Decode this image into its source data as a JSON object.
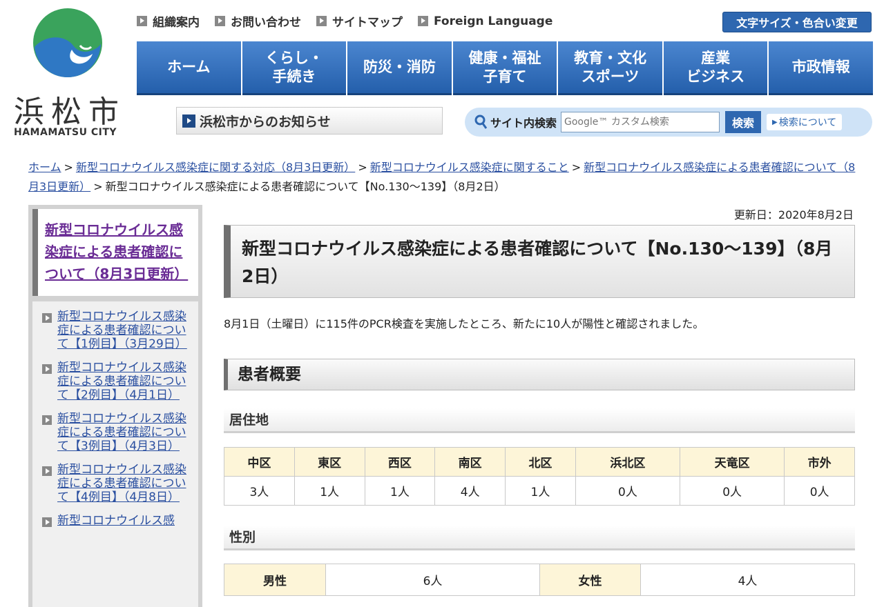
{
  "site": {
    "logo_text": "浜松市",
    "logo_sub": "HAMAMATSU CITY"
  },
  "utility_links": [
    "組織案内",
    "お問い合わせ",
    "サイトマップ",
    "Foreign Language"
  ],
  "text_size_button": "文字サイズ・色合い変更",
  "global_nav": [
    "ホーム",
    "くらし・\n手続き",
    "防災・消防",
    "健康・福祉\n子育て",
    "教育・文化\nスポーツ",
    "産業\nビジネス",
    "市政情報"
  ],
  "notice_bar": "浜松市からのお知らせ",
  "search": {
    "label": "サイト内検索",
    "placeholder": "Google™ カスタム検索",
    "button": "検索",
    "help": "検索について"
  },
  "breadcrumb": {
    "items": [
      "ホーム",
      "新型コロナウイルス感染症に関する対応（8月3日更新）",
      "新型コロナウイルス感染症に関すること",
      "新型コロナウイルス感染症による患者確認について（8月3日更新）"
    ],
    "current": "新型コロナウイルス感染症による患者確認について【No.130〜139】（8月2日）",
    "separator": ">"
  },
  "sidebar": {
    "heading": "新型コロナウイルス感染症による患者確認について（8月3日更新）",
    "items": [
      "新型コロナウイルス感染症による患者確認について【1例目】（3月29日）",
      "新型コロナウイルス感染症による患者確認について【2例目】（4月1日）",
      "新型コロナウイルス感染症による患者確認について【3例目】（4月3日）",
      "新型コロナウイルス感染症による患者確認について【4例目】（4月8日）",
      "新型コロナウイルス感"
    ]
  },
  "main": {
    "updated": "更新日：2020年8月2日",
    "title": "新型コロナウイルス感染症による患者確認について【No.130〜139】（8月2日）",
    "lead": "8月1日（土曜日）に115件のPCR検査を実施したところ、新たに10人が陽性と確認されました。",
    "section_title": "患者概要",
    "residence": {
      "heading": "居住地",
      "headers": [
        "中区",
        "東区",
        "西区",
        "南区",
        "北区",
        "浜北区",
        "天竜区",
        "市外"
      ],
      "values": [
        "3人",
        "1人",
        "1人",
        "4人",
        "1人",
        "0人",
        "0人",
        "0人"
      ]
    },
    "sex": {
      "heading": "性別",
      "male_label": "男性",
      "male_value": "6人",
      "female_label": "女性",
      "female_value": "4人"
    }
  },
  "colors": {
    "nav_blue": "#245fab",
    "link": "#2a4fa0",
    "visited_link": "#6a2c95",
    "table_header": "#fdf5d8"
  }
}
